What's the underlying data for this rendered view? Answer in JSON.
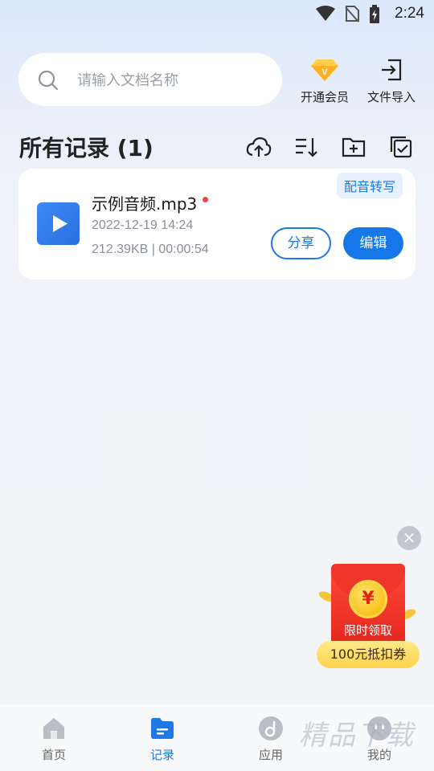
{
  "status": {
    "time": "2:24"
  },
  "search": {
    "placeholder": "请输入文档名称"
  },
  "top_actions": [
    {
      "label": "开通会员",
      "icon": "vip-diamond-icon"
    },
    {
      "label": "文件导入",
      "icon": "import-icon"
    }
  ],
  "records": {
    "title": "所有记录 (1)",
    "toolbar_icons": [
      "cloud-upload-icon",
      "sort-icon",
      "new-folder-icon",
      "multi-select-icon"
    ],
    "items": [
      {
        "tag": "配音转写",
        "name": "示例音频.mp3",
        "date": "2022-12-19 14:24",
        "meta": "212.39KB | 00:00:54",
        "share_label": "分享",
        "edit_label": "编辑"
      }
    ]
  },
  "promo": {
    "coin": "¥",
    "text": "限时领取",
    "pill": "100元抵扣券"
  },
  "nav": [
    {
      "label": "首页",
      "icon": "home-icon",
      "active": false
    },
    {
      "label": "记录",
      "icon": "records-folder-icon",
      "active": true
    },
    {
      "label": "应用",
      "icon": "apps-icon",
      "active": false
    },
    {
      "label": "我的",
      "icon": "profile-icon",
      "active": false
    }
  ],
  "watermark": "精品下载",
  "colors": {
    "accent": "#1677e8",
    "promo_red": "#e2231a",
    "tag_bg": "#e6f1ff"
  }
}
